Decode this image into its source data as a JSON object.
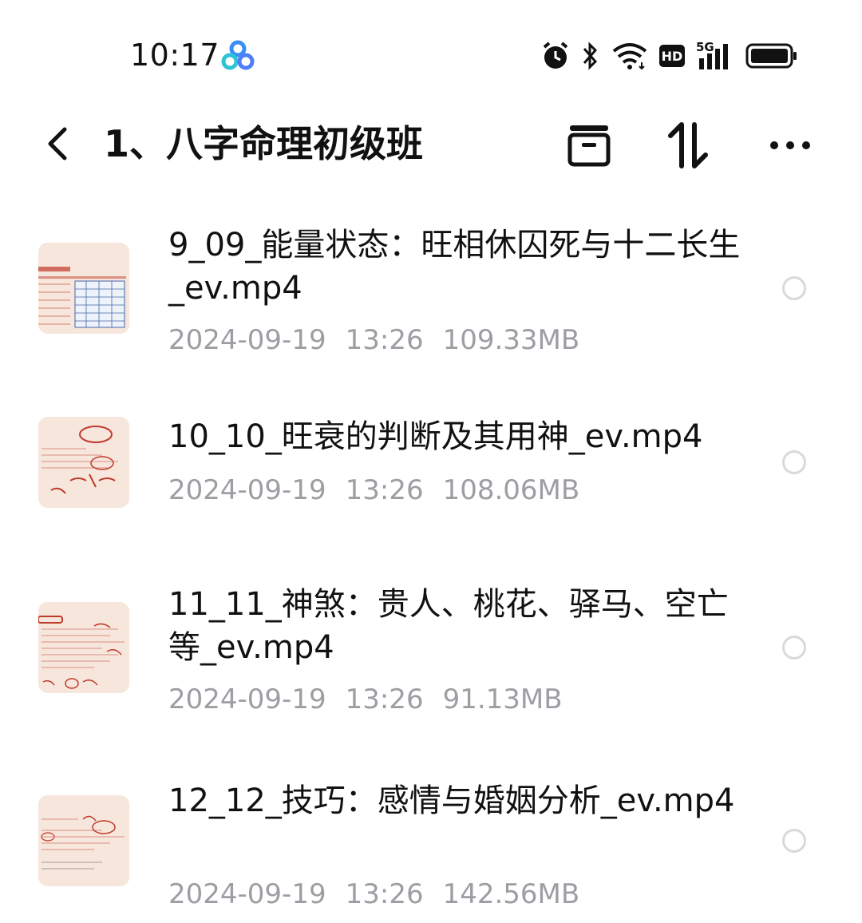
{
  "status_bar": {
    "time": "10:17",
    "app_icon": "cloud-drive-icon",
    "indicators": [
      "alarm-icon",
      "bluetooth-icon",
      "wifi-icon",
      "hd-icon",
      "5g-signal-icon",
      "battery-icon"
    ],
    "hd_label": "HD",
    "network_label": "5G"
  },
  "header": {
    "back_icon": "chevron-left-icon",
    "title": "1、八字命理初级班",
    "actions": [
      "archive-icon",
      "sort-icon",
      "more-icon"
    ]
  },
  "files": [
    {
      "name": "9_09_能量状态：旺相休囚死与十二长生_ev.mp4",
      "date": "2024-09-19",
      "time": "13:26",
      "size": "109.33MB",
      "thumbnail": "table-thumbnail"
    },
    {
      "name": "10_10_旺衰的判断及其用神_ev.mp4",
      "date": "2024-09-19",
      "time": "13:26",
      "size": "108.06MB",
      "thumbnail": "handwriting-thumbnail"
    },
    {
      "name": "11_11_神煞：贵人、桃花、驿马、空亡等_ev.mp4",
      "date": "2024-09-19",
      "time": "13:26",
      "size": "91.13MB",
      "thumbnail": "notes-thumbnail"
    },
    {
      "name": "12_12_技巧：感情与婚姻分析_ev.mp4",
      "date": "2024-09-19",
      "time": "13:26",
      "size": "142.56MB",
      "thumbnail": "notes-thumbnail"
    }
  ],
  "colors": {
    "text": "#111111",
    "meta": "#9c9ea3",
    "thumb_bg": "#f7e6dc",
    "ink_red": "#c0392b"
  }
}
